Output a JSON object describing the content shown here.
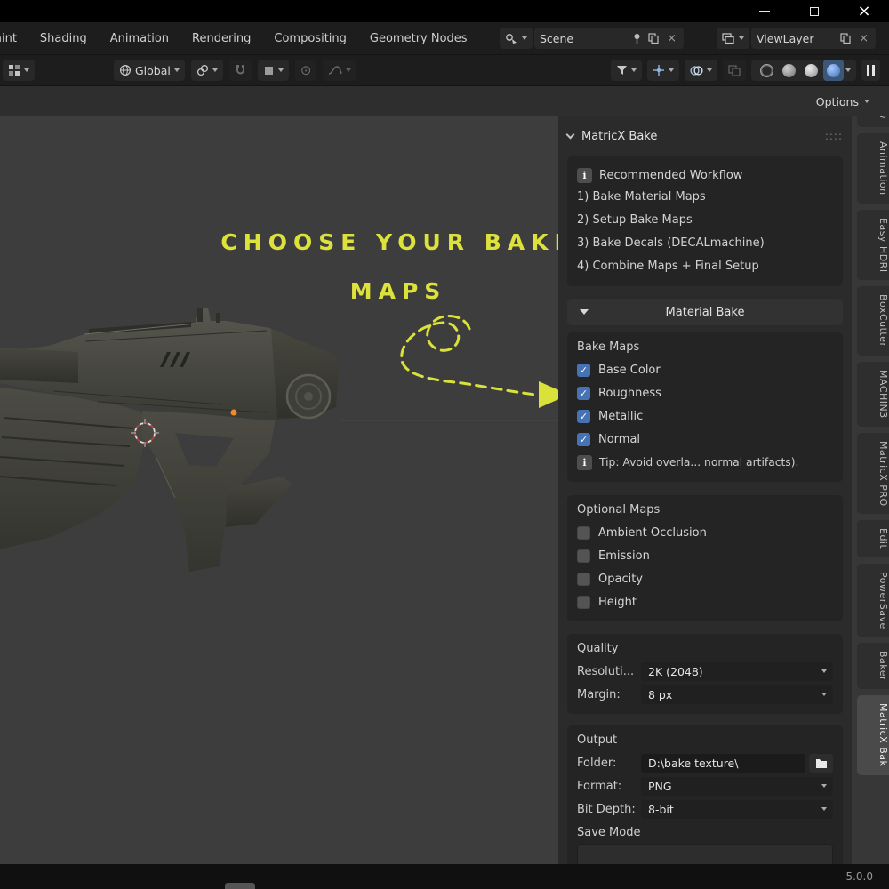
{
  "icons": {
    "close": "×",
    "check": "✓",
    "grip": "::::",
    "prop_edit": "⊙"
  },
  "topbar": {
    "tabs": [
      "aint",
      "Shading",
      "Animation",
      "Rendering",
      "Compositing",
      "Geometry Nodes"
    ],
    "scene_selector": {
      "value": "Scene"
    },
    "view_layer_selector": {
      "value": "ViewLayer"
    }
  },
  "tool_header": {
    "orientation_value": "Global",
    "options_label": "Options"
  },
  "viewport": {
    "annotation": {
      "line1": "CHOOSE YOUR BAKE",
      "line2": "MAPS",
      "color": "#dce23b"
    }
  },
  "side_panel": {
    "title": "MatricX Bake",
    "workflow": {
      "title": "Recommended Workflow",
      "steps": [
        "1) Bake Material Maps",
        "2) Setup Bake Maps",
        "3) Bake Decals (DECALmachine)",
        "4) Combine Maps + Final Setup"
      ]
    },
    "material_bake": {
      "header": "Material Bake",
      "bake_maps_label": "Bake Maps",
      "bake_maps": [
        {
          "label": "Base Color",
          "checked": true
        },
        {
          "label": "Roughness",
          "checked": true
        },
        {
          "label": "Metallic",
          "checked": true
        },
        {
          "label": "Normal",
          "checked": true
        }
      ],
      "tip": "Tip: Avoid overla... normal artifacts).",
      "optional_maps_label": "Optional Maps",
      "optional_maps": [
        {
          "label": "Ambient Occlusion",
          "checked": false
        },
        {
          "label": "Emission",
          "checked": false
        },
        {
          "label": "Opacity",
          "checked": false
        },
        {
          "label": "Height",
          "checked": false
        }
      ],
      "quality": {
        "title": "Quality",
        "resolution_label": "Resoluti...",
        "resolution_value": "2K (2048)",
        "margin_label": "Margin:",
        "margin_value": "8 px"
      },
      "output": {
        "title": "Output",
        "folder_label": "Folder:",
        "folder_value": "D:\\bake texture\\",
        "format_label": "Format:",
        "format_value": "PNG",
        "bit_depth_label": "Bit Depth:",
        "bit_depth_value": "8-bit",
        "save_mode_label": "Save Mode"
      }
    }
  },
  "side_tabs": [
    "View",
    "Animation",
    "Easy HDRI",
    "BoxCutter",
    "MACHIN3",
    "MatricX PRO",
    "Edit",
    "PowerSave",
    "Baker",
    "MatricX Bak"
  ],
  "active_side_tab": "MatricX Bak",
  "status": {
    "version": "5.0.0"
  }
}
